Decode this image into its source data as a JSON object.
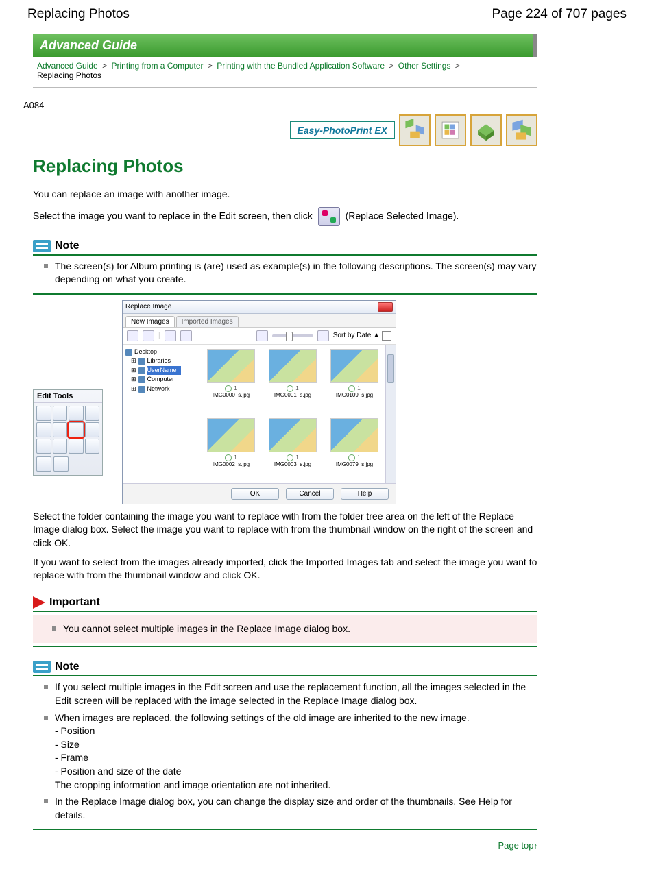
{
  "topbar": {
    "title": "Replacing Photos",
    "page_of": "Page 224 of 707 pages"
  },
  "banner": "Advanced Guide",
  "breadcrumb": {
    "items": [
      "Advanced Guide",
      "Printing from a Computer",
      "Printing with the Bundled Application Software",
      "Other Settings"
    ],
    "current": "Replacing Photos",
    "sep": ">"
  },
  "code": "A084",
  "logo": "Easy-PhotoPrint EX",
  "h1": "Replacing Photos",
  "intro": "You can replace an image with another image.",
  "select_text_pre": "Select the image you want to replace in the Edit screen, then click",
  "select_text_post": "(Replace Selected Image).",
  "note_label": "Note",
  "important_label": "Important",
  "note1": {
    "item1": "The screen(s) for Album printing is (are) used as example(s) in the following descriptions. The screen(s) may vary depending on what you create."
  },
  "tools": {
    "title": "Edit Tools"
  },
  "dialog": {
    "title": "Replace Image",
    "tab_new": "New Images",
    "tab_imported": "Imported Images",
    "sort": "Sort by Date ▲",
    "tree": {
      "desktop": "Desktop",
      "libraries": "Libraries",
      "username": "UserName",
      "computer": "Computer",
      "network": "Network"
    },
    "thumbs": [
      "IMG0000_s.jpg",
      "IMG0001_s.jpg",
      "IMG0109_s.jpg",
      "IMG0002_s.jpg",
      "IMG0003_s.jpg",
      "IMG0079_s.jpg"
    ],
    "thumb_count": "1",
    "ok": "OK",
    "cancel": "Cancel",
    "help": "Help"
  },
  "para_after1": "Select the folder containing the image you want to replace with from the folder tree area on the left of the Replace Image dialog box. Select the image you want to replace with from the thumbnail window on the right of the screen and click OK.",
  "para_after2": "If you want to select from the images already imported, click the Imported Images tab and select the image you want to replace with from the thumbnail window and click OK.",
  "important": {
    "item1": "You cannot select multiple images in the Replace Image dialog box."
  },
  "note2": {
    "item1": "If you select multiple images in the Edit screen and use the replacement function, all the images selected in the Edit screen will be replaced with the image selected in the Replace Image dialog box.",
    "item2": "When images are replaced, the following settings of the old image are inherited to the new image.",
    "sub1": "- Position",
    "sub2": "- Size",
    "sub3": "- Frame",
    "sub4": "- Position and size of the date",
    "sub_after": "The cropping information and image orientation are not inherited.",
    "item3": "In the Replace Image dialog box, you can change the display size and order of the thumbnails. See Help for details."
  },
  "page_top": "Page top"
}
